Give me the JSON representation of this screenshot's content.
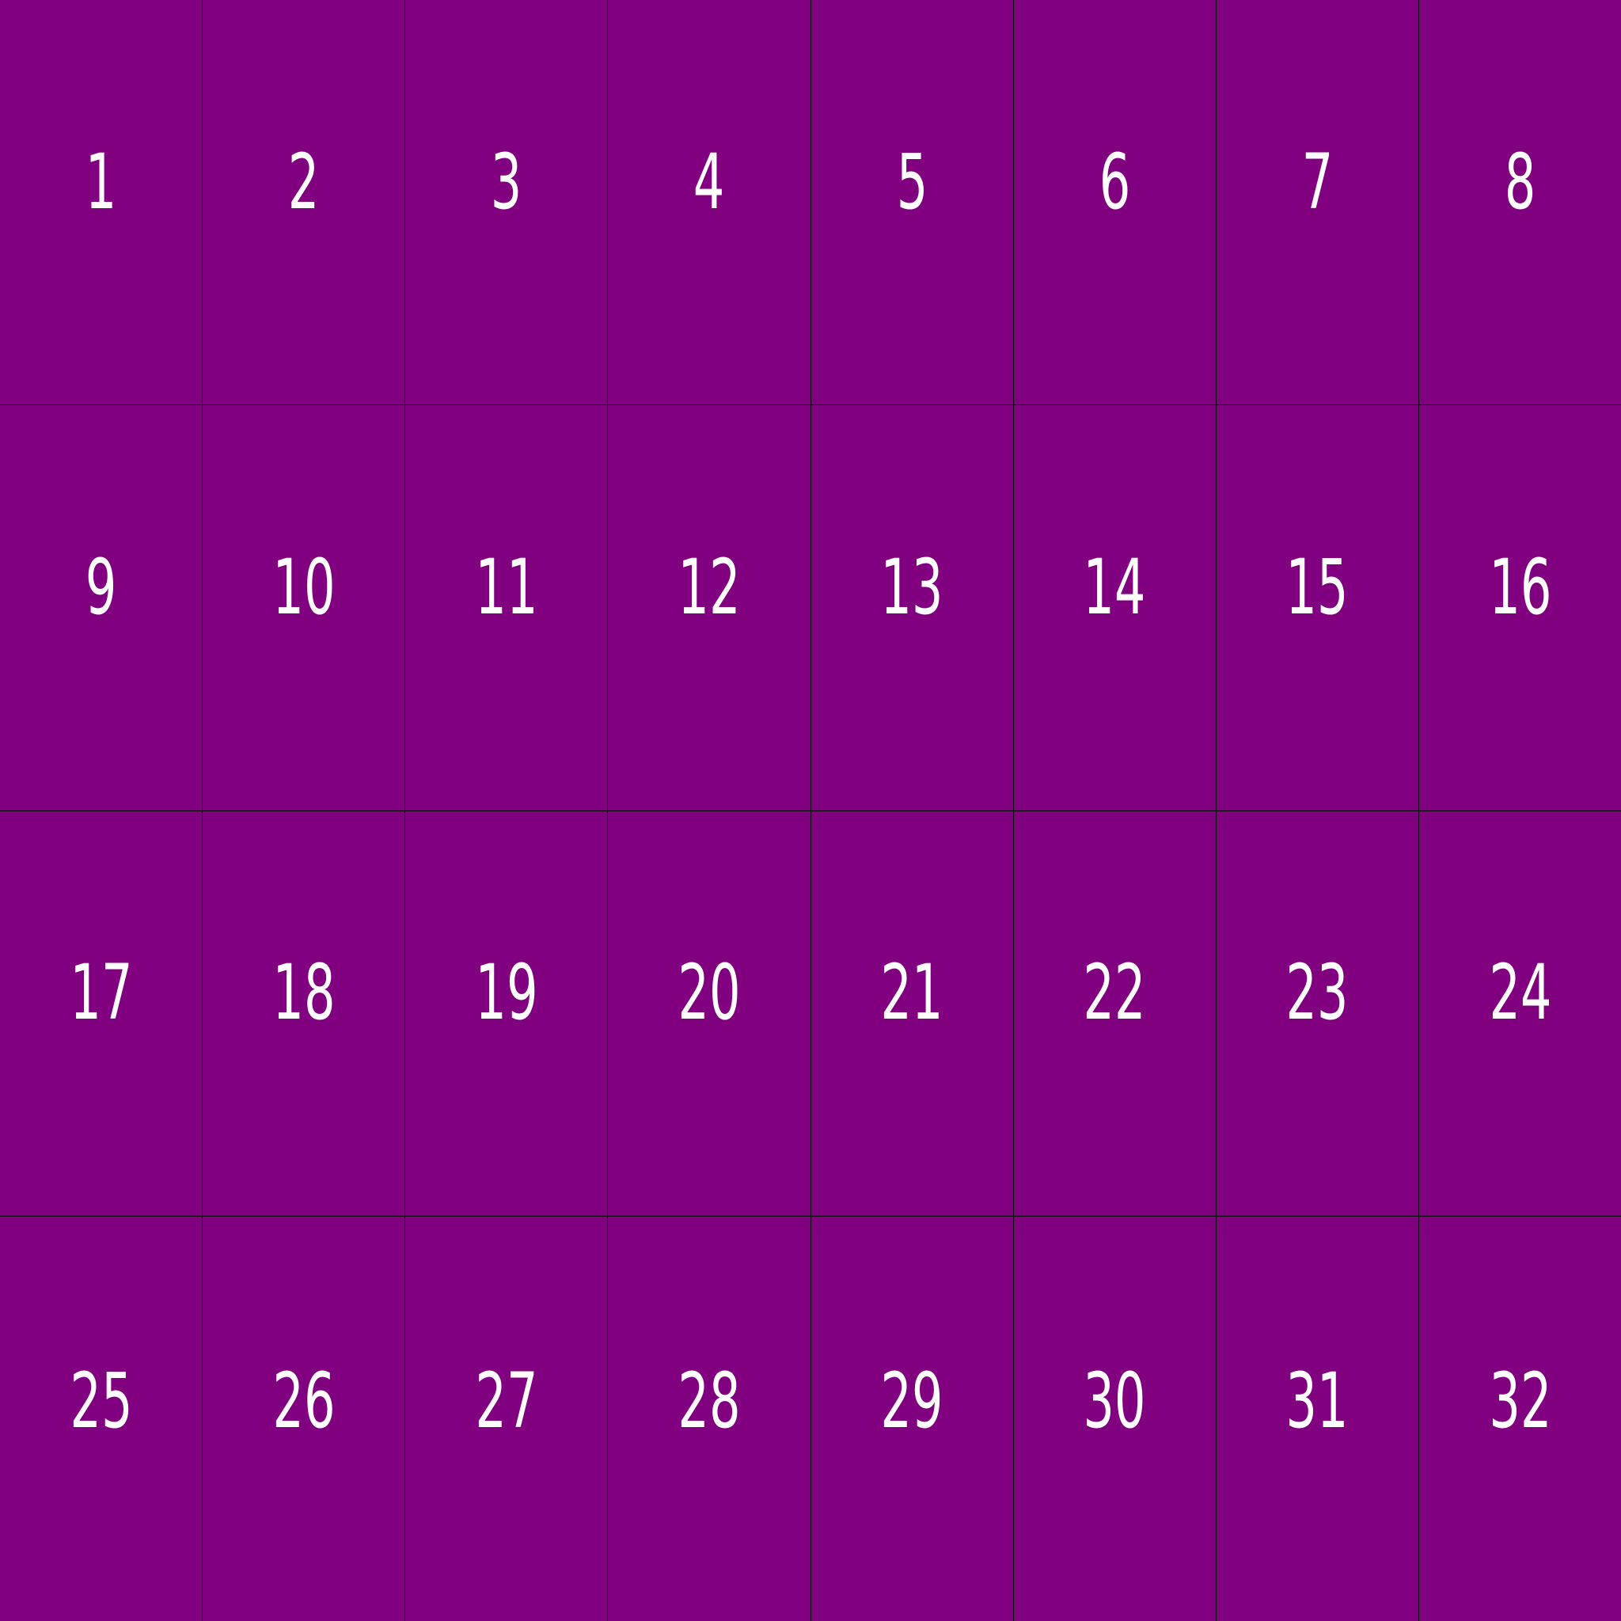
{
  "grid": {
    "columns": 8,
    "rows": 4,
    "cell_color": "#800080",
    "border_color": "#000000",
    "text_color": "#ffffff",
    "cells": [
      "1",
      "2",
      "3",
      "4",
      "5",
      "6",
      "7",
      "8",
      "9",
      "10",
      "11",
      "12",
      "13",
      "14",
      "15",
      "16",
      "17",
      "18",
      "19",
      "20",
      "21",
      "22",
      "23",
      "24",
      "25",
      "26",
      "27",
      "28",
      "29",
      "30",
      "31",
      "32"
    ]
  }
}
